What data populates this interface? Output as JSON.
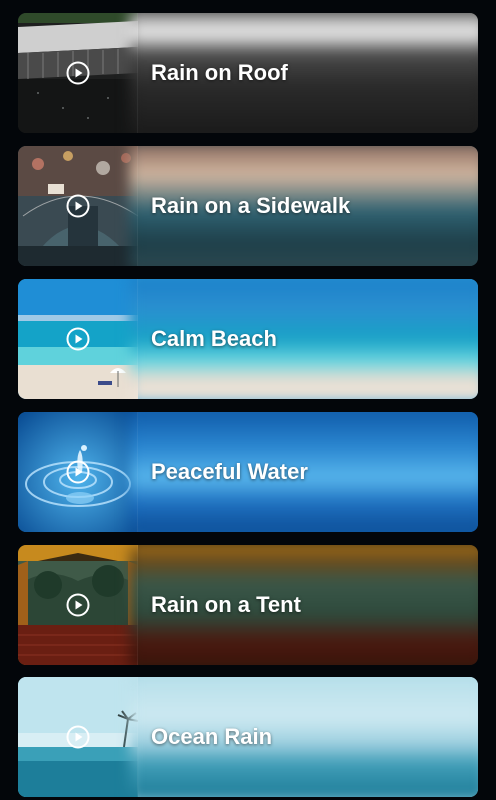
{
  "sounds": [
    {
      "title": "Rain on Roof",
      "icon": "play-circle-icon"
    },
    {
      "title": "Rain on a Sidewalk",
      "icon": "play-circle-icon"
    },
    {
      "title": "Calm Beach",
      "icon": "play-circle-icon"
    },
    {
      "title": "Peaceful Water",
      "icon": "play-circle-icon"
    },
    {
      "title": "Rain on a Tent",
      "icon": "play-circle-icon"
    },
    {
      "title": "Ocean Rain",
      "icon": "play-circle-icon"
    }
  ],
  "colors": {
    "background": "#03060a",
    "title_text": "#ffffff"
  }
}
